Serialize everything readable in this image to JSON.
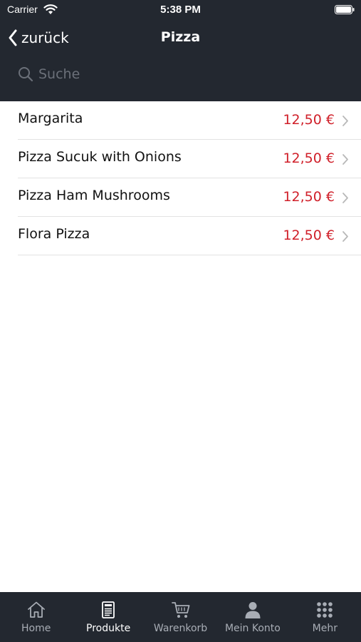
{
  "status_bar": {
    "carrier": "Carrier",
    "time": "5:38 PM"
  },
  "nav": {
    "back_label": "zurück",
    "title": "Pizza"
  },
  "search": {
    "placeholder": "Suche"
  },
  "products": [
    {
      "name": "Margarita",
      "price": "12,50 €"
    },
    {
      "name": "Pizza Sucuk with Onions",
      "price": "12,50 €"
    },
    {
      "name": "Pizza Ham Mushrooms",
      "price": "12,50 €"
    },
    {
      "name": "Flora Pizza",
      "price": "12,50 €"
    }
  ],
  "tabs": [
    {
      "label": "Home",
      "icon": "home-icon",
      "active": false
    },
    {
      "label": "Produkte",
      "icon": "menu-card-icon",
      "active": true
    },
    {
      "label": "Warenkorb",
      "icon": "cart-icon",
      "active": false
    },
    {
      "label": "Mein Konto",
      "icon": "person-icon",
      "active": false
    },
    {
      "label": "Mehr",
      "icon": "grid-dots-icon",
      "active": false
    }
  ],
  "colors": {
    "header_bg": "#232830",
    "price": "#d0202a",
    "tab_inactive": "#a8adb5",
    "tab_active": "#ffffff"
  }
}
